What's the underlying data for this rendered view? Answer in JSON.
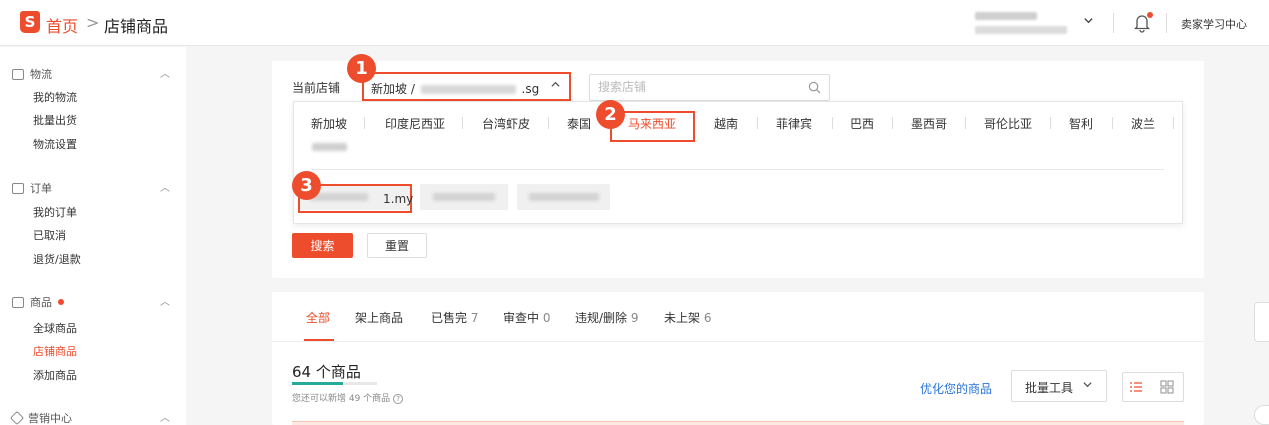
{
  "header": {
    "logo_letter": "S",
    "breadcrumb_home": "首页",
    "breadcrumb_sep": ">",
    "breadcrumb_current": "店铺商品",
    "learning_center": "卖家学习中心",
    "bell_icon": "bell-icon",
    "accent_color": "#ee4d2d"
  },
  "sidebar": {
    "groups": [
      {
        "label": "物流",
        "icon": "truck-icon",
        "items": [
          "我的物流",
          "批量出货",
          "物流设置"
        ]
      },
      {
        "label": "订单",
        "icon": "clipboard-icon",
        "items": [
          "我的订单",
          "已取消",
          "退货/退款"
        ]
      },
      {
        "label": "商品",
        "icon": "box-icon",
        "items": [
          "全球商品",
          "店铺商品",
          "添加商品"
        ],
        "active_item": "店铺商品"
      },
      {
        "label": "营销中心",
        "icon": "tag-icon",
        "items": []
      }
    ]
  },
  "filter": {
    "current_store_label": "当前店铺",
    "store_prefix": "新加坡 /",
    "store_suffix": ".sg",
    "search_placeholder": "搜索店铺",
    "regions": [
      "新加坡",
      "印度尼西亚",
      "台湾虾皮",
      "泰国",
      "马来西亚",
      "越南",
      "菲律宾",
      "巴西",
      "墨西哥",
      "哥伦比亚",
      "智利",
      "波兰"
    ],
    "selected_region": "马来西亚",
    "selected_store_suffix": "1.my",
    "search_button": "搜索",
    "reset_button": "重置",
    "markers": [
      "1",
      "2",
      "3"
    ]
  },
  "products": {
    "tabs": [
      {
        "label": "全部",
        "count": ""
      },
      {
        "label": "架上商品",
        "count": ""
      },
      {
        "label": "已售完",
        "count": "7"
      },
      {
        "label": "审查中",
        "count": "0"
      },
      {
        "label": "违规/删除",
        "count": "9"
      },
      {
        "label": "未上架",
        "count": "6"
      }
    ],
    "count_title": "64 个商品",
    "quota_text": "您还可以新增 49 个商品",
    "optimize_link": "优化您的商品",
    "bulk_tools": "批量工具"
  }
}
